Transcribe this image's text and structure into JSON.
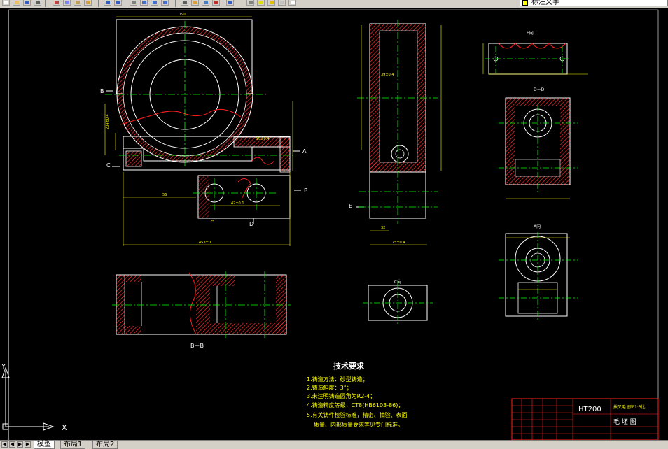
{
  "toolbar": {
    "text_style_value": "标注文字",
    "icons": [
      "new-icon",
      "open-icon",
      "save-icon",
      "print-icon",
      "cut-icon",
      "copy-icon",
      "paste-icon",
      "match-icon",
      "undo-icon",
      "redo-icon",
      "pan-icon",
      "zoom-realtime-icon",
      "zoom-window-icon",
      "zoom-previous-icon",
      "properties-icon",
      "design-center-icon",
      "tool-palette-icon",
      "markup-icon",
      "help-icon",
      "layer-icon",
      "lightbulb-icon",
      "sun-icon",
      "lock-icon",
      "color-icon"
    ]
  },
  "colors": {
    "background": "#000000",
    "outline": "#ffffff",
    "hatch": "#ff3030",
    "centerline": "#00ff00",
    "dimension": "#ffff00",
    "title_border": "#ff2020",
    "tech_text": "#ffff00"
  },
  "drawing": {
    "labels": {
      "section_bb": "B－B",
      "view_e": "E向",
      "view_dd": "D－D",
      "view_a": "A向",
      "view_c": "C向",
      "mark_b_left": "B",
      "mark_b_right": "B",
      "mark_a": "A",
      "mark_c": "C",
      "mark_d": "D",
      "mark_e": "E"
    },
    "tech_title": "技术要求",
    "tech_lines": [
      "1.铸造方法：砂型铸造；",
      "2.铸造斜度：3°；",
      "3.未注明铸造圆角为R2-4；",
      "4.铸造精度等级：CT8(HB6103-86)；",
      "5.有关铸件检验标准，精密、抽验、表面",
      "质量、内部质量要求等见专门标准。"
    ]
  },
  "title_block": {
    "material": "HT200",
    "part_name": "拨叉毛坯图1:3比",
    "drawing_type": "毛 坯 图"
  },
  "ucs": {
    "x_label": "X",
    "y_label": "Y"
  },
  "tabs": {
    "model": "模型",
    "layout1": "布局1",
    "layout2": "布局2"
  }
}
